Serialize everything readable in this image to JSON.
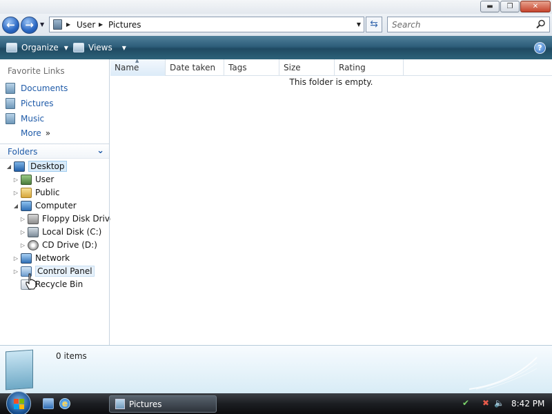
{
  "window": {
    "controls": {
      "minimize": "▬",
      "maximize": "❐",
      "close": "✕"
    }
  },
  "address": {
    "breadcrumbs": [
      "User",
      "Pictures"
    ],
    "search_placeholder": "Search"
  },
  "commandbar": {
    "organize_label": "Organize",
    "views_label": "Views",
    "help_label": "?"
  },
  "navpane": {
    "favorites_title": "Favorite Links",
    "favorites": [
      "Documents",
      "Pictures",
      "Music"
    ],
    "more_label": "More",
    "folders_title": "Folders",
    "tree": [
      {
        "label": "Desktop",
        "icon": "desktop-icon"
      },
      {
        "label": "User",
        "icon": "user-icon"
      },
      {
        "label": "Public",
        "icon": "folder-icon"
      },
      {
        "label": "Computer",
        "icon": "computer-icon"
      },
      {
        "label": "Floppy Disk Drive",
        "icon": "floppy-icon"
      },
      {
        "label": "Local Disk (C:)",
        "icon": "disk-icon"
      },
      {
        "label": "CD Drive (D:)",
        "icon": "cd-icon"
      },
      {
        "label": "Network",
        "icon": "network-icon"
      },
      {
        "label": "Control Panel",
        "icon": "control-panel-icon"
      },
      {
        "label": "Recycle Bin",
        "icon": "recycle-bin-icon"
      }
    ]
  },
  "content": {
    "columns": [
      "Name",
      "Date taken",
      "Tags",
      "Size",
      "Rating"
    ],
    "empty_message": "This folder is empty."
  },
  "details": {
    "item_count": "0 items"
  },
  "taskbar": {
    "task_label": "Pictures",
    "clock": "8:42 PM"
  },
  "colors": {
    "link_blue": "#1e5aa8",
    "commandbar_teal": "#2e5e7a",
    "taskbar_dark": "#1c1e22"
  }
}
